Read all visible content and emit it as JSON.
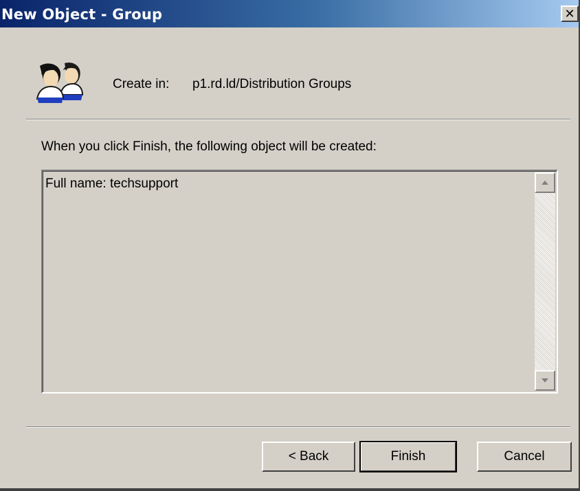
{
  "window": {
    "title": "New Object - Group",
    "close_glyph": "✕"
  },
  "header": {
    "icon": "group-users-icon",
    "create_in_label": "Create in:",
    "create_in_path": "p1.rd.ld/Distribution Groups"
  },
  "body": {
    "instruction": "When you click Finish, the following object will be created:",
    "summary_text": "Full name: techsupport"
  },
  "buttons": {
    "back": "< Back",
    "finish": "Finish",
    "cancel": "Cancel"
  },
  "colors": {
    "titlebar_start": "#0a246a",
    "titlebar_end": "#a6caf0",
    "face": "#d4d0c8"
  }
}
